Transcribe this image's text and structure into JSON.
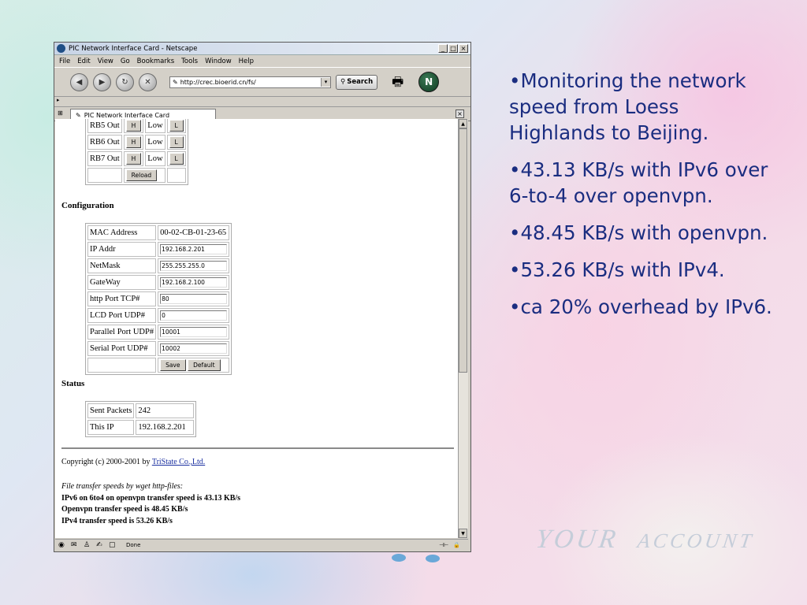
{
  "browser": {
    "title": "PIC Network Interface Card - Netscape",
    "menu": [
      "File",
      "Edit",
      "View",
      "Go",
      "Bookmarks",
      "Tools",
      "Window",
      "Help"
    ],
    "url": "http://crec.bioerid.cn/fs/",
    "search_label": "Search",
    "tab_title": "PIC Network Interface Card",
    "status_text": "Done"
  },
  "page": {
    "rb_rows": [
      {
        "label": "RB5 Out",
        "h": "H",
        "value": "Low",
        "l": "L"
      },
      {
        "label": "RB6 Out",
        "h": "H",
        "value": "Low",
        "l": "L"
      },
      {
        "label": "RB7 Out",
        "h": "H",
        "value": "Low",
        "l": "L"
      }
    ],
    "reload_label": "Reload",
    "config_heading": "Configuration",
    "config": {
      "mac_label": "MAC Address",
      "mac_value": "00-02-CB-01-23-65",
      "ip_label": "IP Addr",
      "ip_value": "192.168.2.201",
      "mask_label": "NetMask",
      "mask_value": "255.255.255.0",
      "gw_label": "GateWay",
      "gw_value": "192.168.2.100",
      "http_label": "http Port TCP#",
      "http_value": "80",
      "lcd_label": "LCD Port UDP#",
      "lcd_value": "0",
      "par_label": "Parallel Port UDP#",
      "par_value": "10001",
      "ser_label": "Serial Port UDP#",
      "ser_value": "10002",
      "save_label": "Save",
      "default_label": "Default"
    },
    "status_heading": "Status",
    "status": {
      "sent_label": "Sent Packets",
      "sent_value": "242",
      "thisip_label": "This IP",
      "thisip_value": "192.168.2.201"
    },
    "copyright_prefix": "Copyright (c) 2000-2001 by ",
    "copyright_link": "TriState Co.,Ltd.",
    "notes_title": "File transfer speeds by wget http-files:",
    "notes": [
      "IPv6 on 6to4 on openvpn transfer speed is 43.13 KB/s",
      "Openvpn transfer speed is 48.45 KB/s",
      "IPv4 transfer speed is 53.26 KB/s"
    ]
  },
  "slide": {
    "bullets": [
      "•Monitoring the network speed from Loess Highlands to Beijing.",
      "•43.13 KB/s with IPv6 over 6-to-4 over openvpn.",
      "•48.45 KB/s with openvpn.",
      "•53.26 KB/s with IPv4.",
      "•ca 20% overhead by IPv6."
    ],
    "background_text": "YOUR ACCOUNT"
  }
}
